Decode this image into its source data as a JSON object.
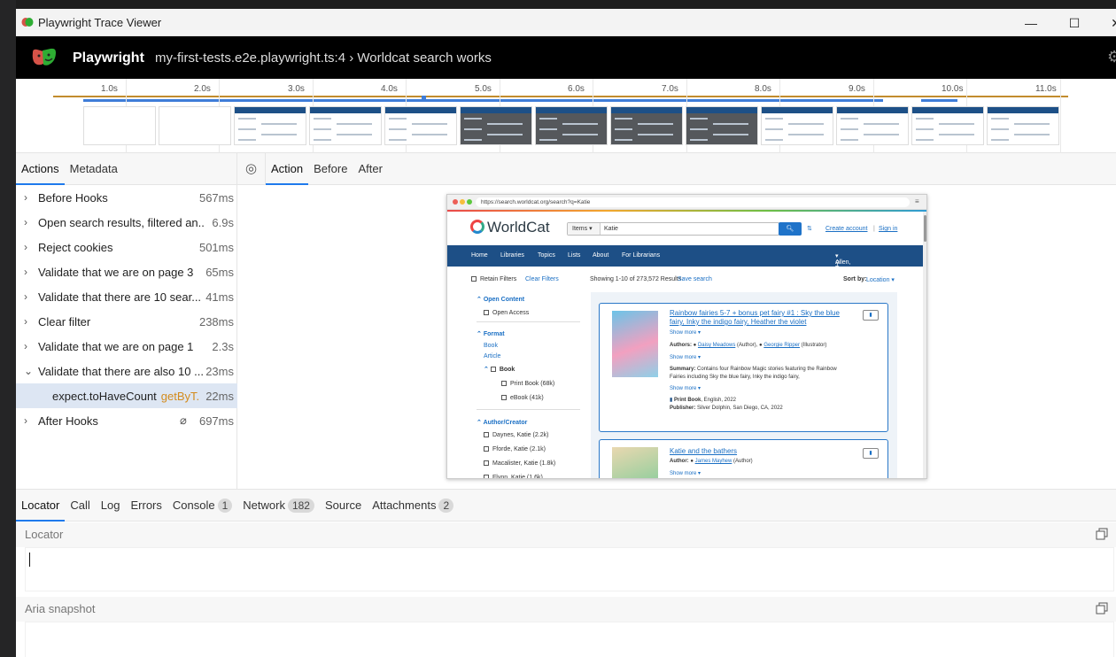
{
  "window": {
    "title": "Playwright Trace Viewer",
    "minimize": "—",
    "maximize": "☐",
    "close": "✕"
  },
  "header": {
    "brand": "Playwright",
    "breadcrumb": "my-first-tests.e2e.playwright.ts:4 › Worldcat search works"
  },
  "timeline": {
    "ticks": [
      "1.0s",
      "2.0s",
      "3.0s",
      "4.0s",
      "5.0s",
      "6.0s",
      "7.0s",
      "8.0s",
      "9.0s",
      "10.0s",
      "11.0s"
    ]
  },
  "left_tabs": [
    "Actions",
    "Metadata"
  ],
  "actions": [
    {
      "label": "Before Hooks",
      "duration": "567ms",
      "expanded": false
    },
    {
      "label": "Open search results, filtered an...",
      "duration": "6.9s",
      "expanded": false
    },
    {
      "label": "Reject cookies",
      "duration": "501ms",
      "expanded": false
    },
    {
      "label": "Validate that we are on page 3",
      "duration": "65ms",
      "expanded": false
    },
    {
      "label": "Validate that there are 10 sear...",
      "duration": "41ms",
      "expanded": false
    },
    {
      "label": "Clear filter",
      "duration": "238ms",
      "expanded": false
    },
    {
      "label": "Validate that we are on page 1",
      "duration": "2.3s",
      "expanded": false
    },
    {
      "label": "Validate that there are also 10 ...",
      "duration": "23ms",
      "expanded": true
    },
    {
      "label": "expect.toHaveCount",
      "locator": "getByT...",
      "duration": "22ms",
      "selected": true
    },
    {
      "label": "After Hooks",
      "duration": "697ms",
      "expanded": false
    }
  ],
  "right_tabs": [
    "Action",
    "Before",
    "After"
  ],
  "snapshot": {
    "url": "https://search.worldcat.org/search?q=Katie",
    "logo": "WorldCat",
    "search_scope": "Items",
    "search_query": "Katie",
    "create_account": "Create account",
    "sign_in": "Sign in",
    "nav": [
      "Home",
      "Libraries",
      "Topics",
      "Lists",
      "About",
      "For Librarians"
    ],
    "location": "Allen, Texas, US",
    "retain_filters": "Retain Filters",
    "clear_filters": "Clear Filters",
    "showing": "Showing 1-10 of 273,572 Results",
    "save_search": "Save search",
    "sort_label": "Sort by:",
    "sort_value": "Location",
    "facets": {
      "open_content": "Open Content",
      "open_access": "Open Access",
      "format": "Format",
      "book": "Book",
      "article": "Article",
      "book_sub": "Book",
      "print_book": "Print Book (68k)",
      "ebook": "eBook (41k)",
      "author_creator": "Author/Creator",
      "authors": [
        "Daynes, Katie (2.2k)",
        "Fforde, Katie (2.1k)",
        "Macalister, Katie (1.8k)",
        "Flynn, Katie (1.6k)"
      ]
    },
    "result1": {
      "title": "Rainbow fairies 5-7 + bonus pet fairy #1 : Sky the blue fairy, Inky the indigo fairy, Heather the violet",
      "show_more": "Show more",
      "authors_label": "Authors:",
      "author1": "Daisy Meadows",
      "author1_role": "(Author),",
      "author2": "Georgie Ripper",
      "author2_role": "(Illustrator)",
      "summary_label": "Summary:",
      "summary": "Contains four Rainbow Magic stories featuring the Rainbow Fairies including Sky the blue fairy, Inky the indigo fairy,",
      "format": "Print Book",
      "format_detail": ", English, 2022",
      "publisher_label": "Publisher:",
      "publisher": "Silver Dolphin, San Diego, CA, 2022"
    },
    "result2": {
      "title": "Katie and the bathers",
      "author_label": "Author:",
      "author": "James Mayhew",
      "author_role": "(Author)",
      "show_more": "Show more"
    }
  },
  "bottom_tabs": [
    {
      "label": "Locator"
    },
    {
      "label": "Call"
    },
    {
      "label": "Log"
    },
    {
      "label": "Errors"
    },
    {
      "label": "Console",
      "badge": "1"
    },
    {
      "label": "Network",
      "badge": "182"
    },
    {
      "label": "Source"
    },
    {
      "label": "Attachments",
      "badge": "2"
    }
  ],
  "locator_section": "Locator",
  "aria_section": "Aria snapshot",
  "colors": {
    "accent": "#1f7aec",
    "timeline_orange": "#c28c2d",
    "locator_orange": "#d38b1d",
    "worldcat_nav": "#1d4f86"
  }
}
